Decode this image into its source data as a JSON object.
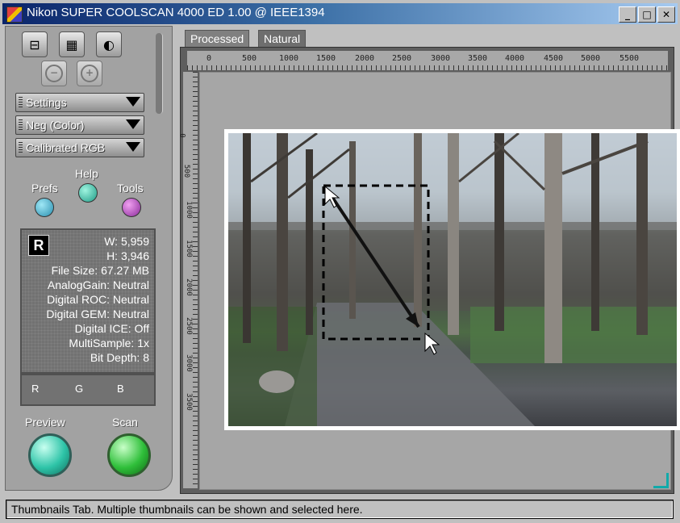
{
  "window": {
    "title": "Nikon SUPER COOLSCAN 4000 ED 1.00 @ IEEE1394",
    "controls": {
      "minimize": "_",
      "maximize": "□",
      "close": "✕"
    }
  },
  "panel": {
    "tools": [
      {
        "name": "scan-area-icon",
        "glyph": "⊟"
      },
      {
        "name": "grain-icon",
        "glyph": "▦"
      },
      {
        "name": "contrast-icon",
        "glyph": "◐"
      }
    ],
    "zoom": {
      "out": "−",
      "in": "+"
    },
    "dropdowns": [
      "Settings",
      "Neg (Color)",
      "Calibrated RGB"
    ],
    "labels": {
      "prefs": "Prefs",
      "help": "Help",
      "tools": "Tools",
      "preview": "Preview",
      "scan": "Scan"
    },
    "info": {
      "channel_badge": "R",
      "lines": [
        "W: 5,959",
        "H: 3,946",
        "File Size: 67.27 MB",
        "AnalogGain: Neutral",
        "Digital ROC: Neutral",
        "Digital GEM: Neutral",
        "Digital ICE: Off",
        "MultiSample: 1x",
        "Bit Depth: 8"
      ]
    },
    "rgb": [
      "R",
      "G",
      "B"
    ]
  },
  "tabs": [
    "Processed",
    "Natural"
  ],
  "active_tab": "Processed",
  "ruler_h": [
    "0",
    "500",
    "1000",
    "1500",
    "2000",
    "2500",
    "3000",
    "3500",
    "4000",
    "4500",
    "5000",
    "5500"
  ],
  "ruler_v": [
    "0",
    "500",
    "1000",
    "1500",
    "2000",
    "2500",
    "3000",
    "3500"
  ],
  "status": "Thumbnails Tab. Multiple thumbnails can be shown and selected here.",
  "colors": {
    "title_start": "#0a246a",
    "title_end": "#a6caf0",
    "panel": "#a2a2a2",
    "preview_button": "#2ec4a8",
    "scan_button": "#2fbf3a"
  }
}
